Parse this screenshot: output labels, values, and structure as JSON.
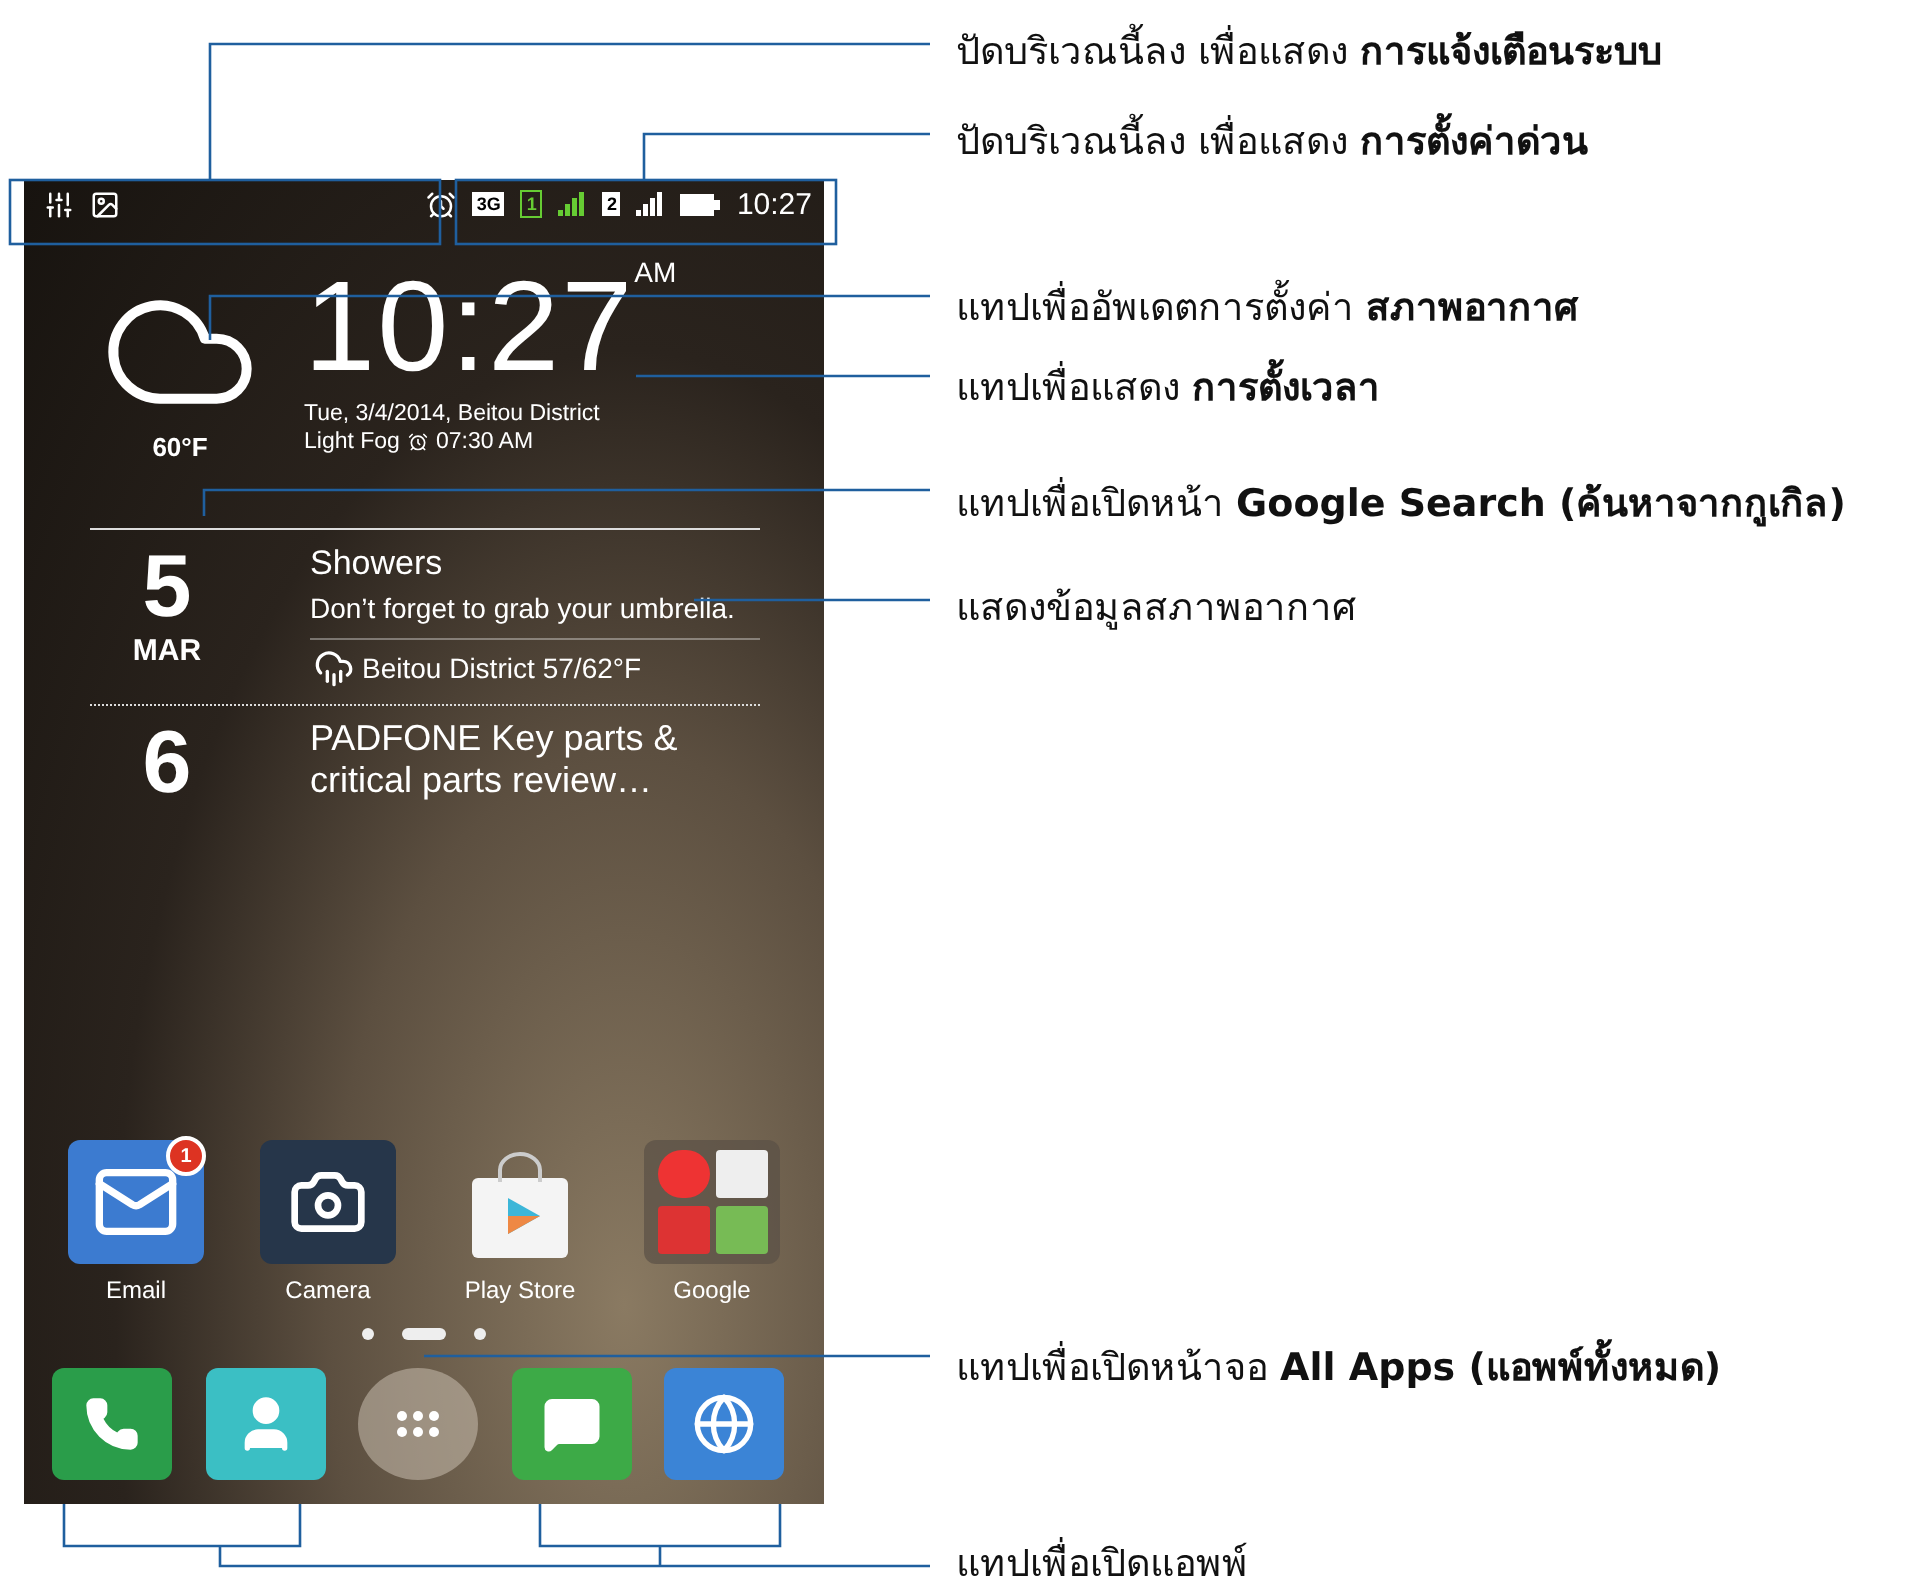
{
  "status_bar": {
    "network": "3G",
    "sim_1": "1",
    "sim_2": "2",
    "time": "10:27"
  },
  "clock_widget": {
    "temperature": "60°F",
    "time": "10:27",
    "meridiem": "AM",
    "date_location": "Tue, 3/4/2014, Beitou District",
    "condition": "Light Fog",
    "alarm": "07:30 AM"
  },
  "events": [
    {
      "kind": "weather",
      "day": "5",
      "month": "MAR",
      "title": "Showers",
      "description": "Don’t forget to grab your umbrella.",
      "location": "Beitou District",
      "range": "57/62°F"
    },
    {
      "kind": "task",
      "day": "6",
      "title": "PADFONE Key parts & critical parts review…"
    }
  ],
  "apps": [
    {
      "kind": "email",
      "label": "Email",
      "badge": "1"
    },
    {
      "kind": "camera",
      "label": "Camera"
    },
    {
      "kind": "store",
      "label": "Play Store"
    },
    {
      "kind": "folder",
      "label": "Google"
    }
  ],
  "page_dots": [
    {
      "selected": false
    },
    {
      "selected": true
    },
    {
      "selected": false
    }
  ],
  "dock": [
    {
      "kind": "phone"
    },
    {
      "kind": "contacts"
    },
    {
      "kind": "all_apps"
    },
    {
      "kind": "messages"
    },
    {
      "kind": "browser"
    }
  ],
  "callouts": [
    "ปัดบริเวณนี้ลง เพื่อแสดง **การแจ้งเตือนระบบ**",
    "ปัดบริเวณนี้ลง เพื่อแสดง **การตั้งค่าด่วน**",
    "แทปเพื่ออัพเดตการตั้งค่า **สภาพอากาศ**",
    "แทปเพื่อแสดง **การตั้งเวลา**",
    "แทปเพื่อเปิดหน้า **Google Search (ค้นหาจากกูเกิล)**",
    "แสดงข้อมูลสภาพอากาศ",
    "แทปเพื่อเปิดหน้าจอ **All Apps (แอพพ์ทั้งหมด)**",
    "แทปเพื่อเปิดแอพพ์"
  ]
}
